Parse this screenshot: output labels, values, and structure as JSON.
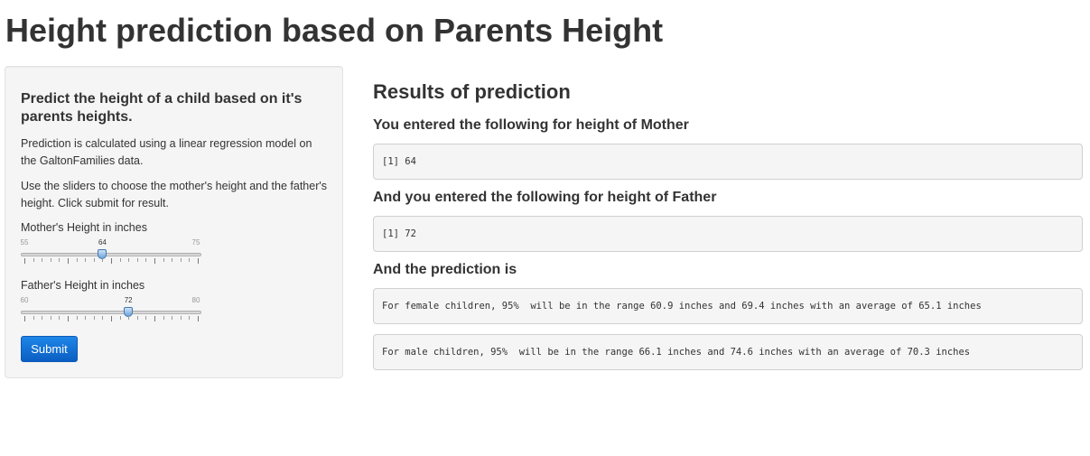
{
  "page": {
    "title": "Height prediction based on Parents Height"
  },
  "sidebar": {
    "heading": "Predict the height of a child based on it's parents heights.",
    "paragraph1": "Prediction is calculated using a linear regression model on the GaltonFamilies data.",
    "paragraph2": "Use the sliders to choose the mother's height and the father's height. Click submit for result.",
    "mother_slider": {
      "label": "Mother's Height in inches",
      "min": "55",
      "max": "75",
      "value": "64",
      "min_num": 55,
      "max_num": 75,
      "value_num": 64
    },
    "father_slider": {
      "label": "Father's Height in inches",
      "min": "60",
      "max": "80",
      "value": "72",
      "min_num": 60,
      "max_num": 80,
      "value_num": 72
    },
    "submit_label": "Submit"
  },
  "main": {
    "heading": "Results of prediction",
    "mother_heading": "You entered the following for height of Mother",
    "mother_output": "[1] 64",
    "father_heading": "And you entered the following for height of Father",
    "father_output": "[1] 72",
    "prediction_heading": "And the prediction is",
    "female_output": "For female children, 95%  will be in the range 60.9 inches and 69.4 inches with an average of 65.1 inches",
    "male_output": "For male children, 95%  will be in the range 66.1 inches and 74.6 inches with an average of 70.3 inches"
  },
  "colors": {
    "button": "#0b5ec2",
    "panel": "#f5f5f5",
    "slider_handle": "#6aa2d8"
  }
}
